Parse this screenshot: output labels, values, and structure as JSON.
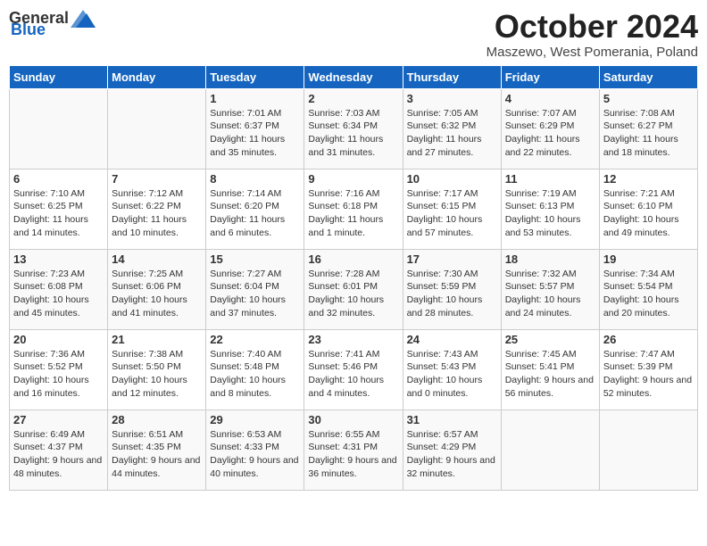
{
  "header": {
    "logo_general": "General",
    "logo_blue": "Blue",
    "month": "October 2024",
    "location": "Maszewo, West Pomerania, Poland"
  },
  "weekdays": [
    "Sunday",
    "Monday",
    "Tuesday",
    "Wednesday",
    "Thursday",
    "Friday",
    "Saturday"
  ],
  "weeks": [
    [
      {
        "day": "",
        "info": ""
      },
      {
        "day": "",
        "info": ""
      },
      {
        "day": "1",
        "info": "Sunrise: 7:01 AM\nSunset: 6:37 PM\nDaylight: 11 hours and 35 minutes."
      },
      {
        "day": "2",
        "info": "Sunrise: 7:03 AM\nSunset: 6:34 PM\nDaylight: 11 hours and 31 minutes."
      },
      {
        "day": "3",
        "info": "Sunrise: 7:05 AM\nSunset: 6:32 PM\nDaylight: 11 hours and 27 minutes."
      },
      {
        "day": "4",
        "info": "Sunrise: 7:07 AM\nSunset: 6:29 PM\nDaylight: 11 hours and 22 minutes."
      },
      {
        "day": "5",
        "info": "Sunrise: 7:08 AM\nSunset: 6:27 PM\nDaylight: 11 hours and 18 minutes."
      }
    ],
    [
      {
        "day": "6",
        "info": "Sunrise: 7:10 AM\nSunset: 6:25 PM\nDaylight: 11 hours and 14 minutes."
      },
      {
        "day": "7",
        "info": "Sunrise: 7:12 AM\nSunset: 6:22 PM\nDaylight: 11 hours and 10 minutes."
      },
      {
        "day": "8",
        "info": "Sunrise: 7:14 AM\nSunset: 6:20 PM\nDaylight: 11 hours and 6 minutes."
      },
      {
        "day": "9",
        "info": "Sunrise: 7:16 AM\nSunset: 6:18 PM\nDaylight: 11 hours and 1 minute."
      },
      {
        "day": "10",
        "info": "Sunrise: 7:17 AM\nSunset: 6:15 PM\nDaylight: 10 hours and 57 minutes."
      },
      {
        "day": "11",
        "info": "Sunrise: 7:19 AM\nSunset: 6:13 PM\nDaylight: 10 hours and 53 minutes."
      },
      {
        "day": "12",
        "info": "Sunrise: 7:21 AM\nSunset: 6:10 PM\nDaylight: 10 hours and 49 minutes."
      }
    ],
    [
      {
        "day": "13",
        "info": "Sunrise: 7:23 AM\nSunset: 6:08 PM\nDaylight: 10 hours and 45 minutes."
      },
      {
        "day": "14",
        "info": "Sunrise: 7:25 AM\nSunset: 6:06 PM\nDaylight: 10 hours and 41 minutes."
      },
      {
        "day": "15",
        "info": "Sunrise: 7:27 AM\nSunset: 6:04 PM\nDaylight: 10 hours and 37 minutes."
      },
      {
        "day": "16",
        "info": "Sunrise: 7:28 AM\nSunset: 6:01 PM\nDaylight: 10 hours and 32 minutes."
      },
      {
        "day": "17",
        "info": "Sunrise: 7:30 AM\nSunset: 5:59 PM\nDaylight: 10 hours and 28 minutes."
      },
      {
        "day": "18",
        "info": "Sunrise: 7:32 AM\nSunset: 5:57 PM\nDaylight: 10 hours and 24 minutes."
      },
      {
        "day": "19",
        "info": "Sunrise: 7:34 AM\nSunset: 5:54 PM\nDaylight: 10 hours and 20 minutes."
      }
    ],
    [
      {
        "day": "20",
        "info": "Sunrise: 7:36 AM\nSunset: 5:52 PM\nDaylight: 10 hours and 16 minutes."
      },
      {
        "day": "21",
        "info": "Sunrise: 7:38 AM\nSunset: 5:50 PM\nDaylight: 10 hours and 12 minutes."
      },
      {
        "day": "22",
        "info": "Sunrise: 7:40 AM\nSunset: 5:48 PM\nDaylight: 10 hours and 8 minutes."
      },
      {
        "day": "23",
        "info": "Sunrise: 7:41 AM\nSunset: 5:46 PM\nDaylight: 10 hours and 4 minutes."
      },
      {
        "day": "24",
        "info": "Sunrise: 7:43 AM\nSunset: 5:43 PM\nDaylight: 10 hours and 0 minutes."
      },
      {
        "day": "25",
        "info": "Sunrise: 7:45 AM\nSunset: 5:41 PM\nDaylight: 9 hours and 56 minutes."
      },
      {
        "day": "26",
        "info": "Sunrise: 7:47 AM\nSunset: 5:39 PM\nDaylight: 9 hours and 52 minutes."
      }
    ],
    [
      {
        "day": "27",
        "info": "Sunrise: 6:49 AM\nSunset: 4:37 PM\nDaylight: 9 hours and 48 minutes."
      },
      {
        "day": "28",
        "info": "Sunrise: 6:51 AM\nSunset: 4:35 PM\nDaylight: 9 hours and 44 minutes."
      },
      {
        "day": "29",
        "info": "Sunrise: 6:53 AM\nSunset: 4:33 PM\nDaylight: 9 hours and 40 minutes."
      },
      {
        "day": "30",
        "info": "Sunrise: 6:55 AM\nSunset: 4:31 PM\nDaylight: 9 hours and 36 minutes."
      },
      {
        "day": "31",
        "info": "Sunrise: 6:57 AM\nSunset: 4:29 PM\nDaylight: 9 hours and 32 minutes."
      },
      {
        "day": "",
        "info": ""
      },
      {
        "day": "",
        "info": ""
      }
    ]
  ]
}
